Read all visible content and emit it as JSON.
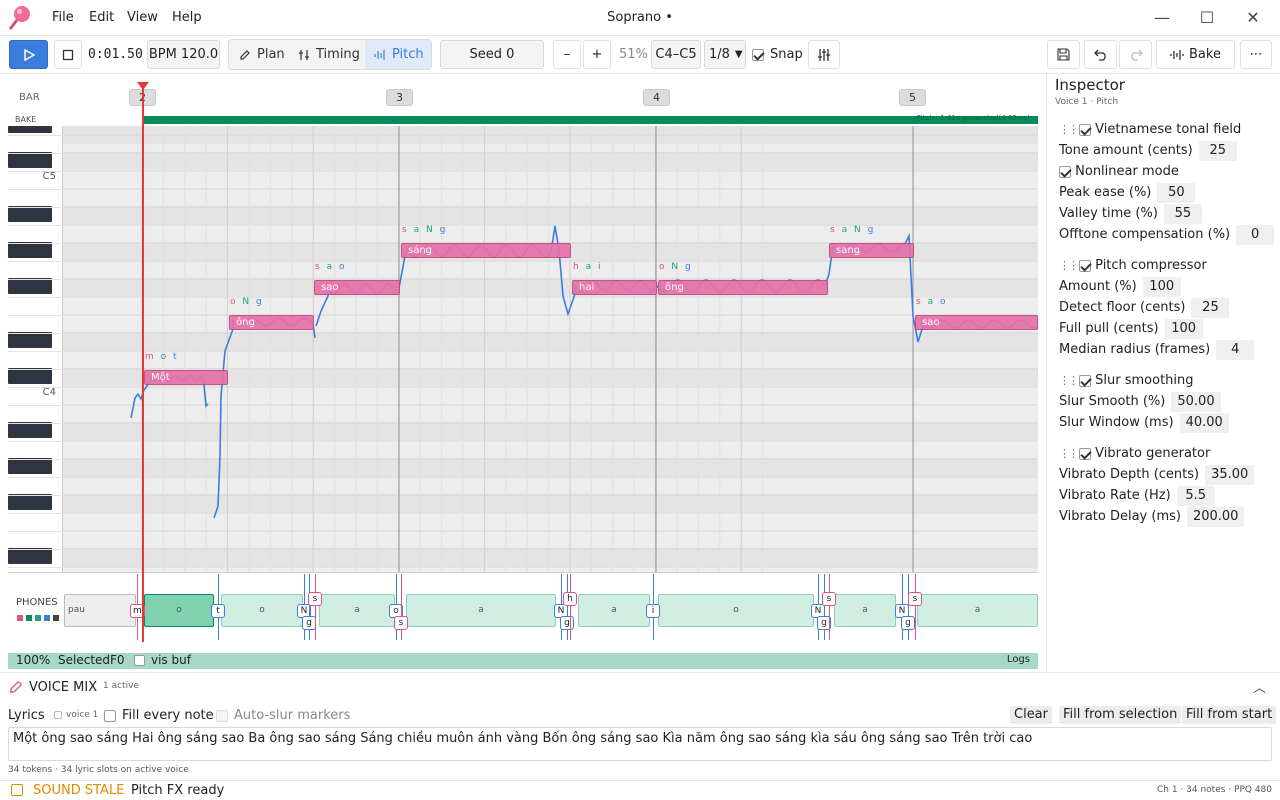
{
  "app": {
    "title": "Soprano •",
    "menu": [
      "File",
      "Edit",
      "View",
      "Help"
    ]
  },
  "toolbar": {
    "time": "0:01.50",
    "bpm": "BPM 120.0",
    "modes": [
      "Plan",
      "Timing",
      "Pitch"
    ],
    "active_mode": "Pitch",
    "seed": "Seed 0",
    "minus": "–",
    "plus": "+",
    "zoom": "51%",
    "range": "C4–C5",
    "quant": "1/8",
    "snap_label": "Snap",
    "snap_checked": true,
    "bake_label": "Bake"
  },
  "ruler": {
    "bar_label": "BAR",
    "bake_label": "BAKE",
    "bars": [
      "2",
      "3",
      "4",
      "5"
    ],
    "bake_text": "Pitch · 1.41x generated(4.82ms)"
  },
  "piano": {
    "labels": [
      "C5",
      "C4"
    ]
  },
  "notes": [
    {
      "text": "Một",
      "phonemes": "m o t"
    },
    {
      "text": "ông",
      "phonemes": "o N g"
    },
    {
      "text": "sao",
      "phonemes": "s a o"
    },
    {
      "text": "sáng",
      "phonemes": "s a N g"
    },
    {
      "text": "hai",
      "phonemes": "h a i"
    },
    {
      "text": "ông",
      "phonemes": "o N g"
    },
    {
      "text": "sang",
      "phonemes": "s a N g"
    },
    {
      "text": "sao",
      "phonemes": "s a o"
    }
  ],
  "phones": {
    "label": "PHONES",
    "segments": [
      "pau",
      "o",
      "o",
      "a",
      "a",
      "a",
      "o",
      "a",
      "a"
    ],
    "tags": [
      "m",
      "t",
      "N",
      "g",
      "s",
      "o",
      "s",
      "N",
      "g",
      "h",
      "i",
      "N",
      "g",
      "s",
      "N",
      "g",
      "s"
    ]
  },
  "status_strip": {
    "zoom": "100%",
    "selected": "SelectedF0",
    "visbuf": "vis buf",
    "logs": "Logs"
  },
  "inspector": {
    "title": "Inspector",
    "subtitle": "Voice 1 · Pitch",
    "sections": [
      {
        "name": "Vietnamese tonal field",
        "enabled": true
      },
      {
        "name": "Pitch compressor",
        "enabled": true
      },
      {
        "name": "Slur smoothing",
        "enabled": true
      },
      {
        "name": "Vibrato generator",
        "enabled": true
      }
    ],
    "params": {
      "tone_amount": {
        "label": "Tone amount (cents)",
        "value": "25"
      },
      "nonlinear": {
        "label": "Nonlinear mode",
        "enabled": true
      },
      "peak_ease": {
        "label": "Peak ease (%)",
        "value": "50"
      },
      "valley_time": {
        "label": "Valley time (%)",
        "value": "55"
      },
      "offtone": {
        "label": "Offtone compensation (%)",
        "value": "0"
      },
      "amount": {
        "label": "Amount (%)",
        "value": "100"
      },
      "detect_floor": {
        "label": "Detect floor (cents)",
        "value": "25"
      },
      "full_pull": {
        "label": "Full pull (cents)",
        "value": "100"
      },
      "median_radius": {
        "label": "Median radius (frames)",
        "value": "4"
      },
      "slur_smooth": {
        "label": "Slur Smooth (%)",
        "value": "50.00"
      },
      "slur_window": {
        "label": "Slur Window (ms)",
        "value": "40.00"
      },
      "vib_depth": {
        "label": "Vibrato Depth (cents)",
        "value": "35.00"
      },
      "vib_rate": {
        "label": "Vibrato Rate (Hz)",
        "value": "5.5"
      },
      "vib_delay": {
        "label": "Vibrato Delay (ms)",
        "value": "200.00"
      }
    }
  },
  "voicemix": {
    "title": "VOICE MIX",
    "count": "1 active"
  },
  "lyrics": {
    "label": "Lyrics",
    "voice": "voice 1",
    "fill_every": "Fill every note",
    "auto_slur": "Auto-slur markers",
    "clear": "Clear",
    "fill_sel": "Fill from selection",
    "fill_start": "Fill from start",
    "text": "Một ông sao sáng Hai ông sáng sao Ba ông sao sáng Sáng chiều muôn ánh vàng Bốn ông sáng sao Kìa năm ông sao sáng kìa sáu ông sáng sao Trên trời cao",
    "meta": "34 tokens · 34 lyric slots on active voice"
  },
  "footer": {
    "stale": "SOUND STALE",
    "status": "Pitch FX ready",
    "right": "Ch 1 · 34 notes · PPQ 480"
  },
  "colors": {
    "accent": "#3b7ddd",
    "note": "#e572a8",
    "playhead": "#e53935",
    "bake_bar": "#0a8a5a",
    "phone_segment": "#cfeee1",
    "stale": "#e08a00"
  }
}
